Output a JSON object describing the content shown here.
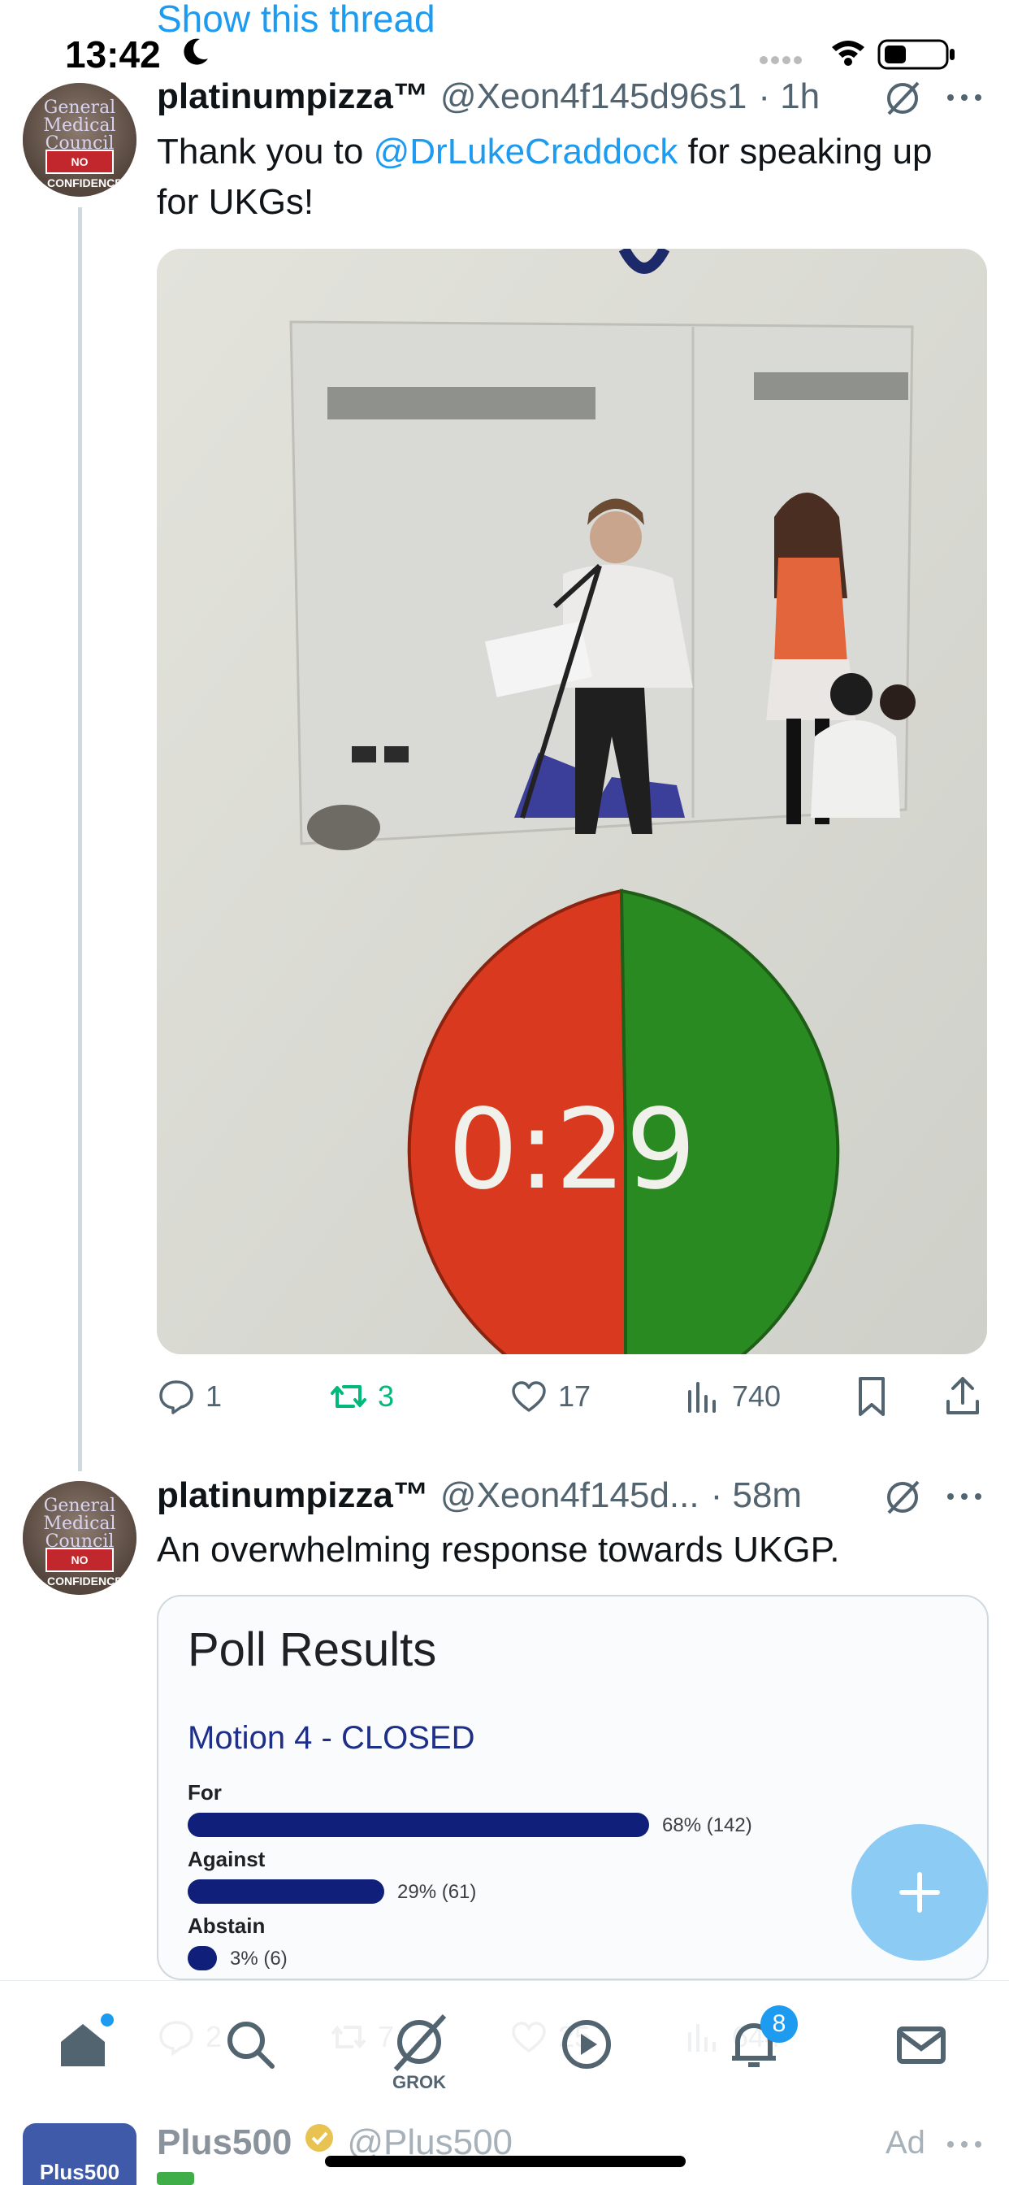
{
  "status_bar": {
    "time": "13:42",
    "show_thread": "Show this thread"
  },
  "tweet1": {
    "name": "platinumpizza™",
    "handle": "@Xeon4f145d96s1",
    "time": "· 1h",
    "text_before": "Thank you to ",
    "mention": "@DrLukeCraddock",
    "text_after": " for speaking up for UKGs!",
    "media": {
      "timer": "0:29"
    },
    "actions": {
      "replies": "1",
      "reposts": "3",
      "likes": "17",
      "views": "740"
    }
  },
  "tweet2": {
    "name": "platinumpizza™",
    "handle": "@Xeon4f145d...",
    "time": "· 58m",
    "text": "An overwhelming response towards UKGP.",
    "poll": {
      "title": "Poll Results",
      "motion": "Motion 4 - CLOSED",
      "options": [
        {
          "label": "For",
          "value": "68% (142)",
          "fraction": 0.68
        },
        {
          "label": "Against",
          "value": "29% (61)",
          "fraction": 0.29
        },
        {
          "label": "Abstain",
          "value": "3% (6)",
          "fraction": 0.03
        }
      ]
    },
    "actions_partial": {
      "replies": "2",
      "reposts": "7",
      "likes": "25",
      "views": "644"
    }
  },
  "avatar_text": {
    "line1": "General",
    "line2": "Medical",
    "line3": "Council",
    "flag": "NO CONFIDENCE"
  },
  "bottom_nav": {
    "grok_label": "GROK",
    "notifications_badge": "8"
  },
  "ad": {
    "name": "Plus500",
    "handle": "@Plus500",
    "ad_label": "Ad",
    "logo": "Plus500"
  },
  "colors": {
    "accent": "#1d9bf0",
    "repost_green": "#00ba7c",
    "poll_bar": "#10207a",
    "timer_red": "#d93a1f",
    "timer_green": "#2a8a22"
  }
}
